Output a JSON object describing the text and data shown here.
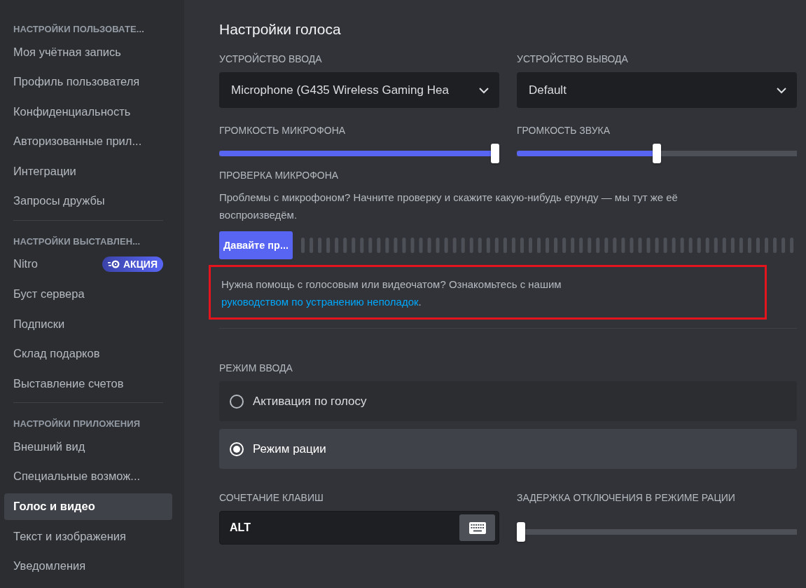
{
  "sidebar": {
    "sections": [
      {
        "header": "НАСТРОЙКИ ПОЛЬЗОВАТЕ...",
        "items": [
          {
            "label": "Моя учётная запись",
            "selected": false
          },
          {
            "label": "Профиль пользователя",
            "selected": false
          },
          {
            "label": "Конфиденциальность",
            "selected": false
          },
          {
            "label": "Авторизованные прил...",
            "selected": false
          },
          {
            "label": "Интеграции",
            "selected": false
          },
          {
            "label": "Запросы дружбы",
            "selected": false
          }
        ]
      },
      {
        "header": "НАСТРОЙКИ ВЫСТАВЛЕН...",
        "items": [
          {
            "label": "Nitro",
            "selected": false,
            "badge": "АКЦИЯ"
          },
          {
            "label": "Буст сервера",
            "selected": false
          },
          {
            "label": "Подписки",
            "selected": false
          },
          {
            "label": "Склад подарков",
            "selected": false
          },
          {
            "label": "Выставление счетов",
            "selected": false
          }
        ]
      },
      {
        "header": "НАСТРОЙКИ ПРИЛОЖЕНИЯ",
        "items": [
          {
            "label": "Внешний вид",
            "selected": false
          },
          {
            "label": "Специальные возмож...",
            "selected": false
          },
          {
            "label": "Голос и видео",
            "selected": true
          },
          {
            "label": "Текст и изображения",
            "selected": false
          },
          {
            "label": "Уведомления",
            "selected": false
          }
        ]
      }
    ]
  },
  "main": {
    "title": "Настройки голоса",
    "devices": [
      {
        "label": "УСТРОЙСТВО ВВОДА",
        "value": "Microphone (G435 Wireless Gaming Hea"
      },
      {
        "label": "УСТРОЙСТВО ВЫВОДА",
        "value": "Default"
      }
    ],
    "volumes": [
      {
        "label": "ГРОМКОСТЬ МИКРОФОНА",
        "level": 1.0
      },
      {
        "label": "ГРОМКОСТЬ ЗВУКА",
        "level": 0.5
      }
    ],
    "mic_test": {
      "label": "ПРОВЕРКА МИКРОФОНА",
      "description": "Проблемы с микрофоном? Начните проверку и скажите какую-нибудь ерунду — мы тут же её воспроизведём.",
      "button": "Давайте пр..."
    },
    "help": {
      "text": "Нужна помощь с голосовым или видеочатом? Ознакомьтесь с нашим ",
      "link": "руководством по устранению неполадок",
      "end": ".",
      "highlighted": true
    },
    "input_mode": {
      "label": "РЕЖИМ ВВОДА",
      "options": [
        {
          "label": "Активация по голосу",
          "selected": false
        },
        {
          "label": "Режим рации",
          "selected": true
        }
      ]
    },
    "shortcut": {
      "label": "СОЧЕТАНИЕ КЛАВИШ",
      "value": "ALT"
    },
    "release_delay": {
      "label": "ЗАДЕРЖКА ОТКЛЮЧЕНИЯ В РЕЖИМЕ РАЦИИ",
      "level": 0
    }
  }
}
